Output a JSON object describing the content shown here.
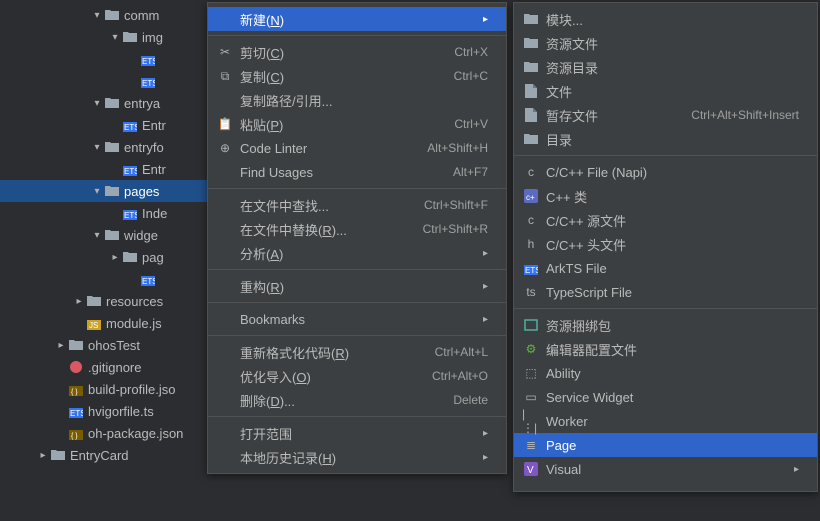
{
  "tree": {
    "items": [
      {
        "depth": 5,
        "arrow": "down",
        "icon": "folder",
        "label": "comm"
      },
      {
        "depth": 6,
        "arrow": "down",
        "icon": "folder",
        "label": "img"
      },
      {
        "depth": 7,
        "arrow": "",
        "icon": "ets",
        "label": ""
      },
      {
        "depth": 7,
        "arrow": "",
        "icon": "ets",
        "label": ""
      },
      {
        "depth": 5,
        "arrow": "down",
        "icon": "folder",
        "label": "entrya"
      },
      {
        "depth": 6,
        "arrow": "",
        "icon": "ets",
        "label": "Entr"
      },
      {
        "depth": 5,
        "arrow": "down",
        "icon": "folder",
        "label": "entryfo"
      },
      {
        "depth": 6,
        "arrow": "",
        "icon": "ets",
        "label": "Entr"
      },
      {
        "depth": 5,
        "arrow": "down",
        "icon": "folder",
        "label": "pages",
        "selected": true
      },
      {
        "depth": 6,
        "arrow": "",
        "icon": "ets",
        "label": "Inde"
      },
      {
        "depth": 5,
        "arrow": "down",
        "icon": "folder",
        "label": "widge"
      },
      {
        "depth": 6,
        "arrow": "right",
        "icon": "folder",
        "label": "pag"
      },
      {
        "depth": 7,
        "arrow": "",
        "icon": "ets",
        "label": ""
      },
      {
        "depth": 4,
        "arrow": "right",
        "icon": "folder",
        "label": "resources"
      },
      {
        "depth": 4,
        "arrow": "",
        "icon": "js",
        "label": "module.js"
      },
      {
        "depth": 3,
        "arrow": "right",
        "icon": "folder",
        "label": "ohosTest"
      },
      {
        "depth": 3,
        "arrow": "",
        "icon": "git",
        "label": ".gitignore"
      },
      {
        "depth": 3,
        "arrow": "",
        "icon": "json",
        "label": "build-profile.jso"
      },
      {
        "depth": 3,
        "arrow": "",
        "icon": "ets",
        "label": "hvigorfile.ts"
      },
      {
        "depth": 3,
        "arrow": "",
        "icon": "json",
        "label": "oh-package.json"
      },
      {
        "depth": 2,
        "arrow": "right",
        "icon": "folder",
        "label": "EntryCard"
      }
    ]
  },
  "menu1": {
    "items": [
      {
        "icon": "",
        "label": "新建(N)",
        "shortcut": "",
        "sub": true,
        "highlight": true,
        "u": "N"
      },
      {
        "sep": true
      },
      {
        "icon": "✂",
        "label": "剪切(C)",
        "shortcut": "Ctrl+X",
        "u": "C"
      },
      {
        "icon": "⧉",
        "label": "复制(C)",
        "shortcut": "Ctrl+C",
        "u": "C"
      },
      {
        "icon": "",
        "label": "复制路径/引用...",
        "shortcut": ""
      },
      {
        "icon": "📋",
        "label": "粘贴(P)",
        "shortcut": "Ctrl+V",
        "u": "P"
      },
      {
        "icon": "⊕",
        "label": "Code Linter",
        "shortcut": "Alt+Shift+H"
      },
      {
        "icon": "",
        "label": "Find Usages",
        "shortcut": "Alt+F7"
      },
      {
        "sep": true
      },
      {
        "icon": "",
        "label": "在文件中查找...",
        "shortcut": "Ctrl+Shift+F"
      },
      {
        "icon": "",
        "label": "在文件中替换(R)...",
        "shortcut": "Ctrl+Shift+R",
        "u": "R"
      },
      {
        "icon": "",
        "label": "分析(A)",
        "shortcut": "",
        "sub": true,
        "u": "A"
      },
      {
        "sep": true
      },
      {
        "icon": "",
        "label": "重构(R)",
        "shortcut": "",
        "sub": true,
        "u": "R"
      },
      {
        "sep": true
      },
      {
        "icon": "",
        "label": "Bookmarks",
        "shortcut": "",
        "sub": true
      },
      {
        "sep": true
      },
      {
        "icon": "",
        "label": "重新格式化代码(R)",
        "shortcut": "Ctrl+Alt+L",
        "u": "R"
      },
      {
        "icon": "",
        "label": "优化导入(O)",
        "shortcut": "Ctrl+Alt+O",
        "u": "O"
      },
      {
        "icon": "",
        "label": "删除(D)...",
        "shortcut": "Delete",
        "u": "D"
      },
      {
        "sep": true
      },
      {
        "icon": "",
        "label": "打开范围",
        "shortcut": "",
        "sub": true
      },
      {
        "icon": "",
        "label": "本地历史记录(H)",
        "shortcut": "",
        "sub": true,
        "u": "H"
      }
    ]
  },
  "menu2": {
    "items": [
      {
        "icon": "folder",
        "label": "模块..."
      },
      {
        "icon": "folder",
        "label": "资源文件"
      },
      {
        "icon": "folder",
        "label": "资源目录"
      },
      {
        "icon": "file",
        "label": "文件"
      },
      {
        "icon": "file",
        "label": "暂存文件",
        "shortcut": "Ctrl+Alt+Shift+Insert"
      },
      {
        "icon": "folder",
        "label": "目录"
      },
      {
        "sep": true
      },
      {
        "icon": "c",
        "label": "C/C++ File (Napi)"
      },
      {
        "icon": "cpp",
        "label": "C++ 类"
      },
      {
        "icon": "c",
        "label": "C/C++ 源文件"
      },
      {
        "icon": "h",
        "label": "C/C++ 头文件"
      },
      {
        "icon": "ets",
        "label": "ArkTS File"
      },
      {
        "icon": "ts",
        "label": "TypeScript File"
      },
      {
        "sep": true
      },
      {
        "icon": "res",
        "label": "资源捆绑包"
      },
      {
        "icon": "gear",
        "label": "编辑器配置文件"
      },
      {
        "icon": "ability",
        "label": "Ability"
      },
      {
        "icon": "widget",
        "label": "Service Widget"
      },
      {
        "icon": "worker",
        "label": "Worker"
      },
      {
        "icon": "page",
        "label": "Page",
        "highlight": true
      },
      {
        "icon": "visual",
        "label": "Visual",
        "sub": true
      }
    ]
  }
}
